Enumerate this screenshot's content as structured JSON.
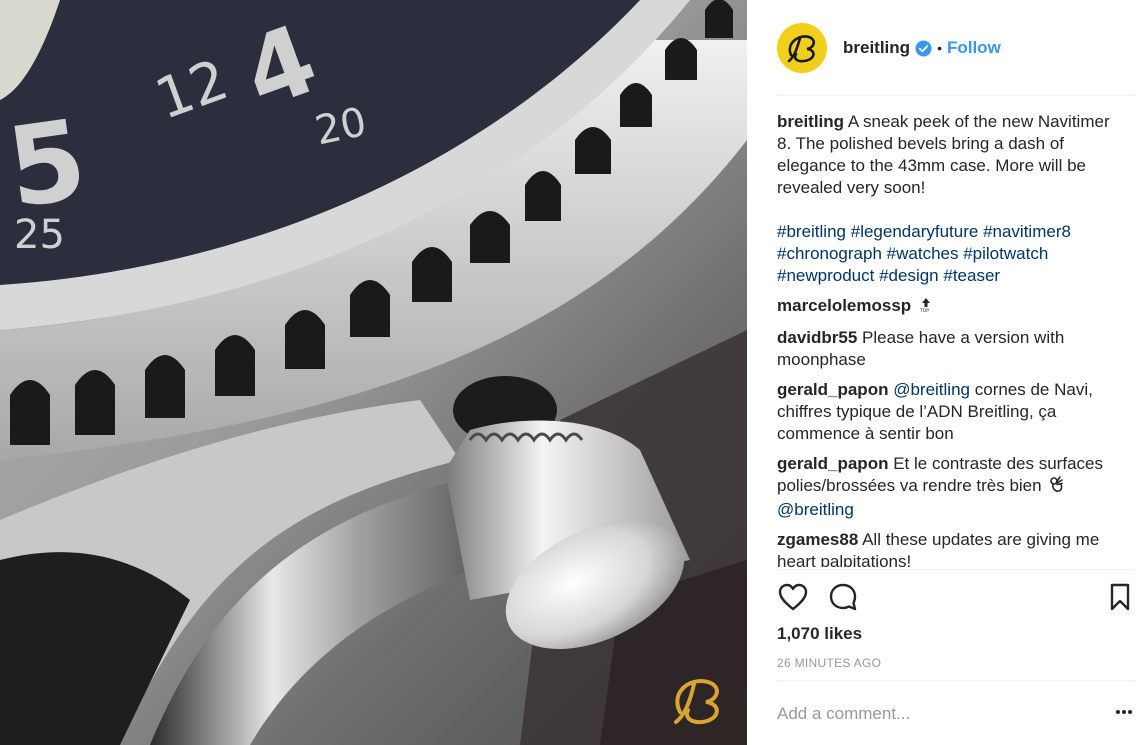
{
  "colors": {
    "follow_blue": "#3897f0",
    "hashtag_blue": "#003569",
    "brand_yellow": "#f2cf1b",
    "muted": "#999999"
  },
  "photo": {
    "alt_icon": "breitling-logo-watermark",
    "dial_numbers": [
      "12",
      "4",
      "20",
      "5",
      "25"
    ]
  },
  "header": {
    "username": "breitling",
    "verified_icon": "verified-badge-icon",
    "separator": "•",
    "follow_label": "Follow"
  },
  "caption": {
    "username": "breitling",
    "text": "A sneak peek of the new Navitimer 8. The polished bevels bring a dash of elegance to the 43mm case. More will be revealed very soon!",
    "hashtags": [
      "#breitling",
      "#legendaryfuture",
      "#navitimer8",
      "#chronograph",
      "#watches",
      "#pilotwatch",
      "#newproduct",
      "#design",
      "#teaser"
    ]
  },
  "comments": [
    {
      "username": "marcelolemossp",
      "text": "",
      "emoji": "top-arrow-emoji"
    },
    {
      "username": "davidbr55",
      "text": "Please have a version with moonphase"
    },
    {
      "username": "gerald_papon",
      "mention": "@breitling",
      "text": "cornes de Navi, chiffres typique de l’ADN Breitling, ça commence à sentir bon"
    },
    {
      "username": "gerald_papon",
      "text": "Et le contraste des surfaces polies/brossées va rendre très bien",
      "emoji": "ok-hand-emoji",
      "mention_after": "@breitling"
    },
    {
      "username": "zgames88",
      "text": "All these updates are giving me heart palpitations!"
    }
  ],
  "actions": {
    "like_icon": "heart-icon",
    "comment_icon": "comment-bubble-icon",
    "save_icon": "bookmark-icon",
    "likes_text": "1,070 likes",
    "time_text": "26 MINUTES AGO"
  },
  "add_comment": {
    "placeholder": "Add a comment...",
    "more_icon": "more-options-icon"
  }
}
